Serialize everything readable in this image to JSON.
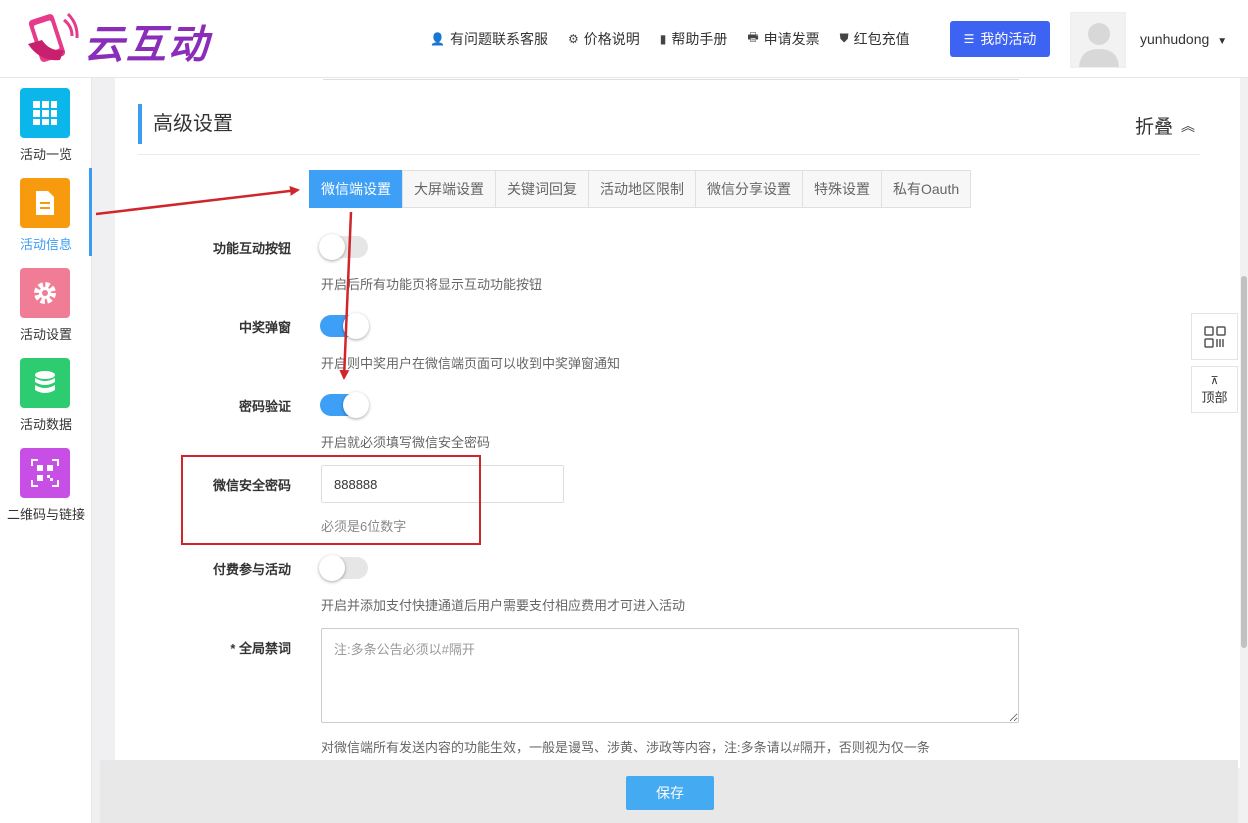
{
  "brand": {
    "name": "云互动"
  },
  "top_nav": [
    {
      "icon": "user-plus-icon",
      "glyph": "👤",
      "label": "有问题联系客服"
    },
    {
      "icon": "gear-icon",
      "glyph": "⚙",
      "label": "价格说明"
    },
    {
      "icon": "book-icon",
      "glyph": "▮",
      "label": "帮助手册"
    },
    {
      "icon": "printer-icon",
      "glyph": "🖶",
      "label": "申请发票"
    },
    {
      "icon": "shield-icon",
      "glyph": "⛊",
      "label": "红包充值"
    }
  ],
  "my_activity_button": "我的活动",
  "user": {
    "name": "yunhudong"
  },
  "sidebar": [
    {
      "label": "活动一览",
      "color": "#0ab6ea",
      "icon": "grid-icon"
    },
    {
      "label": "活动信息",
      "color": "#f79a0e",
      "icon": "document-icon",
      "active": true
    },
    {
      "label": "活动设置",
      "color": "#f07d95",
      "icon": "settings-icon"
    },
    {
      "label": "活动数据",
      "color": "#2ecc71",
      "icon": "database-icon"
    },
    {
      "label": "二维码与链接",
      "color": "#c84fe6",
      "icon": "qrcode-icon"
    }
  ],
  "section": {
    "title": "高级设置",
    "fold_label": "折叠"
  },
  "tabs": [
    "微信端设置",
    "大屏端设置",
    "关键词回复",
    "活动地区限制",
    "微信分享设置",
    "特殊设置",
    "私有Oauth"
  ],
  "settings": {
    "interactive_button": {
      "label": "功能互动按钮",
      "on": false,
      "help": "开启后所有功能页将显示互动功能按钮"
    },
    "prize_popup": {
      "label": "中奖弹窗",
      "on": true,
      "help": "开启则中奖用户在微信端页面可以收到中奖弹窗通知"
    },
    "password_verify": {
      "label": "密码验证",
      "on": true,
      "help": "开启就必须填写微信安全密码"
    },
    "security_password": {
      "label": "微信安全密码",
      "value": "888888",
      "help": "必须是6位数字"
    },
    "paid_join": {
      "label": "付费参与活动",
      "on": false,
      "help": "开启并添加支付快捷通道后用户需要支付相应费用才可进入活动"
    },
    "banned_words": {
      "label": "* 全局禁词",
      "placeholder": "注:多条公告必须以#隔开",
      "help": "对微信端所有发送内容的功能生效，一般是谩骂、涉黄、涉政等内容，注:多条请以#隔开，否则视为仅一条"
    }
  },
  "save_button": "保存",
  "floating": {
    "top_label": "顶部",
    "top_arrow": "⊼"
  },
  "colors": {
    "accent": "#3d9ff5",
    "primary_button": "#3d63f2",
    "annotation_red": "#d0252b"
  }
}
